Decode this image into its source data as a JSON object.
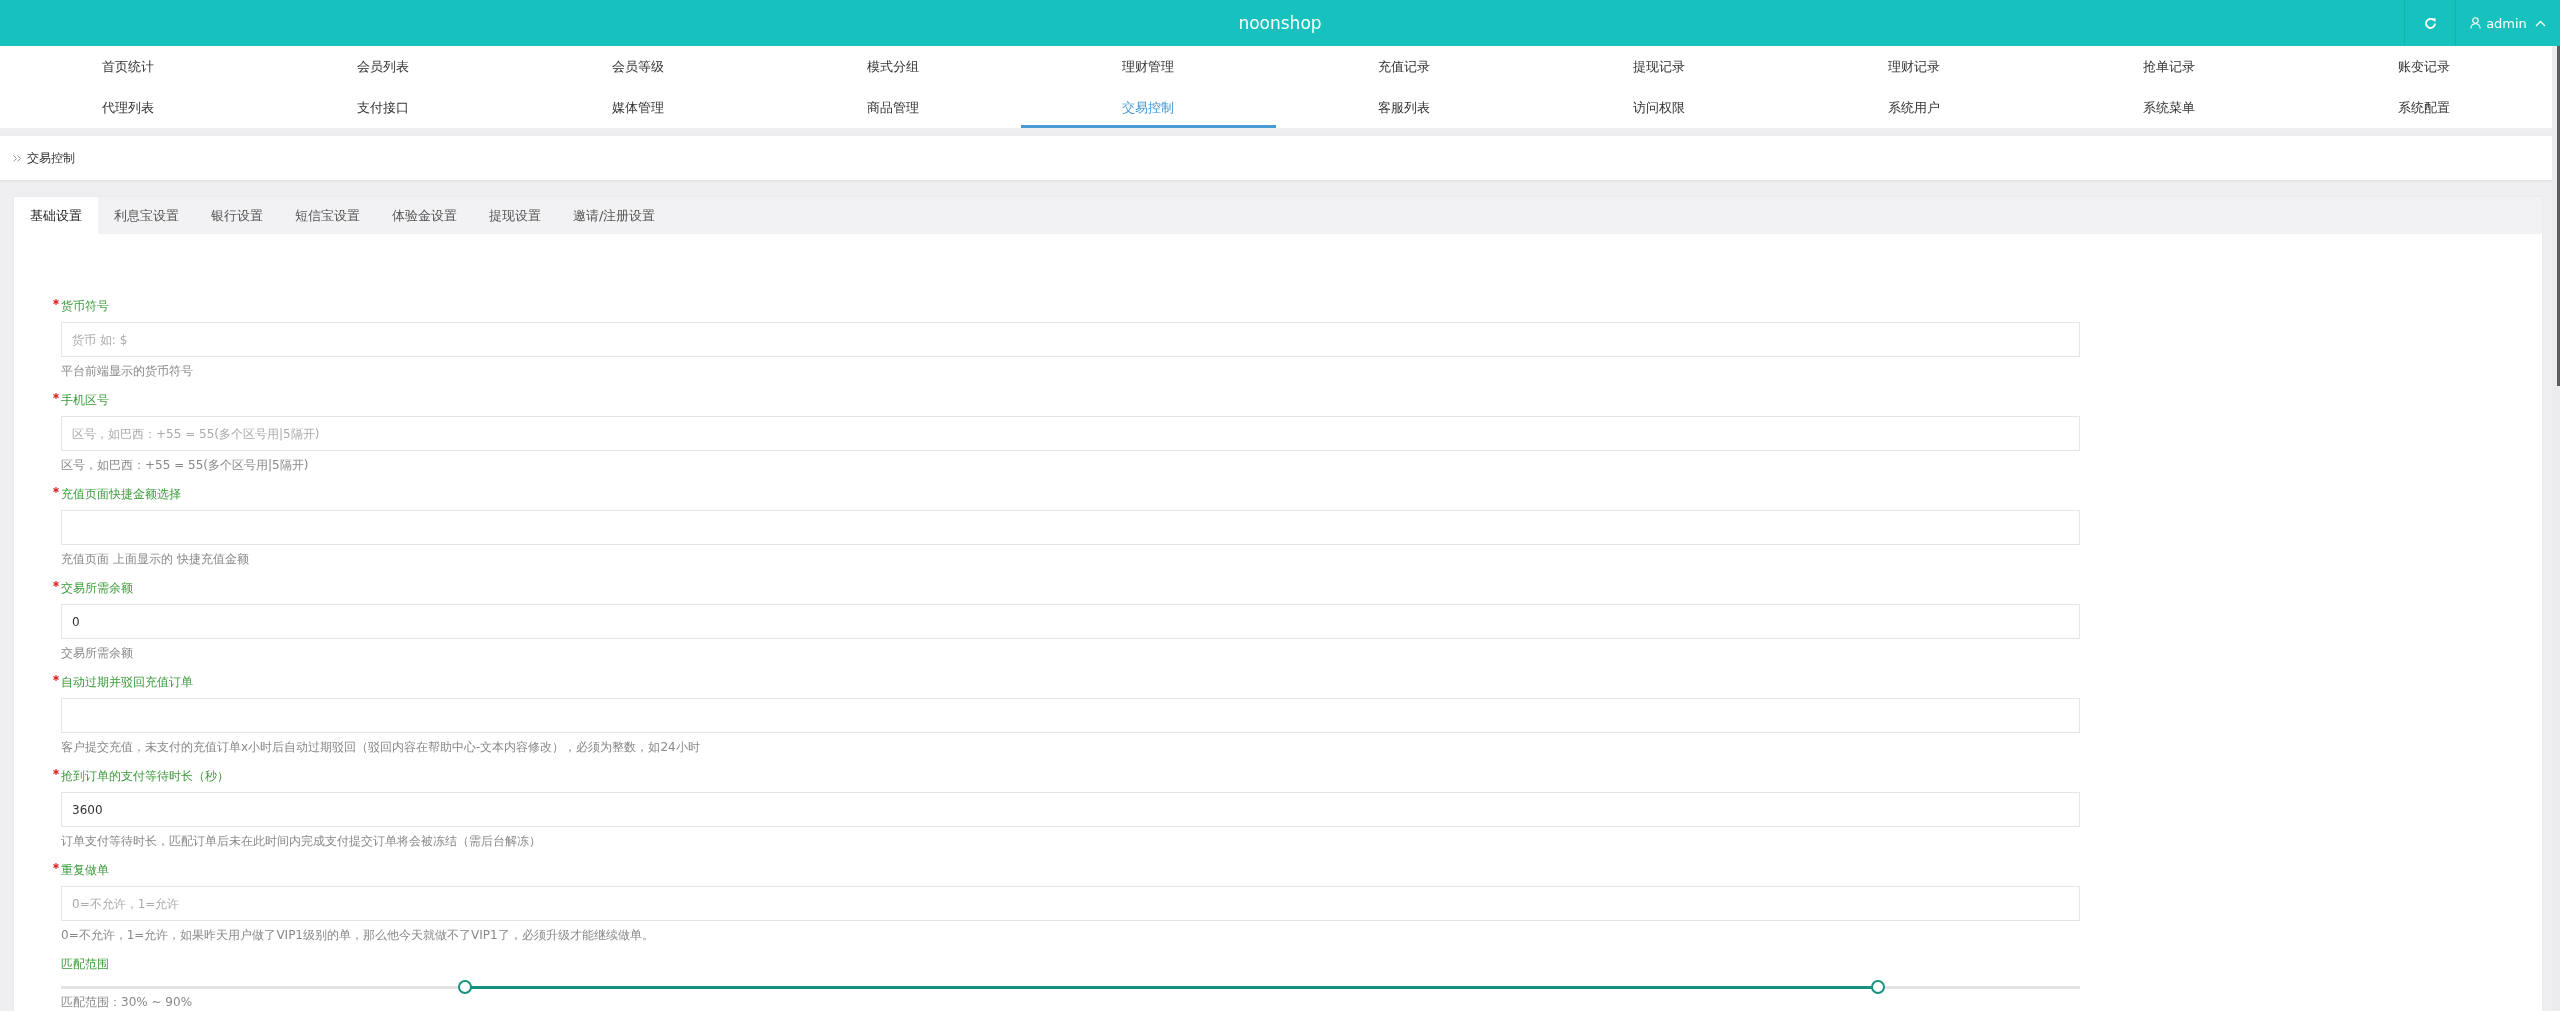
{
  "header": {
    "title": "noonshop",
    "user": "admin"
  },
  "nav": [
    {
      "label": "首页统计",
      "selected": false
    },
    {
      "label": "会员列表",
      "selected": false
    },
    {
      "label": "会员等级",
      "selected": false
    },
    {
      "label": "模式分组",
      "selected": false
    },
    {
      "label": "理财管理",
      "selected": false
    },
    {
      "label": "充值记录",
      "selected": false
    },
    {
      "label": "提现记录",
      "selected": false
    },
    {
      "label": "理财记录",
      "selected": false
    },
    {
      "label": "抢单记录",
      "selected": false
    },
    {
      "label": "账变记录",
      "selected": false
    },
    {
      "label": "代理列表",
      "selected": false
    },
    {
      "label": "支付接口",
      "selected": false
    },
    {
      "label": "媒体管理",
      "selected": false
    },
    {
      "label": "商品管理",
      "selected": false
    },
    {
      "label": "交易控制",
      "selected": true
    },
    {
      "label": "客服列表",
      "selected": false
    },
    {
      "label": "访问权限",
      "selected": false
    },
    {
      "label": "系统用户",
      "selected": false
    },
    {
      "label": "系统菜单",
      "selected": false
    },
    {
      "label": "系统配置",
      "selected": false
    }
  ],
  "breadcrumb": {
    "label": "交易控制"
  },
  "tabs": [
    {
      "label": "基础设置",
      "selected": true
    },
    {
      "label": "利息宝设置",
      "selected": false
    },
    {
      "label": "银行设置",
      "selected": false
    },
    {
      "label": "短信宝设置",
      "selected": false
    },
    {
      "label": "体验金设置",
      "selected": false
    },
    {
      "label": "提现设置",
      "selected": false
    },
    {
      "label": "邀请/注册设置",
      "selected": false
    }
  ],
  "fields": [
    {
      "kind": "input",
      "label": "货币符号",
      "required": true,
      "placeholder": "货币 如: $",
      "help": "平台前端显示的货币符号"
    },
    {
      "kind": "input",
      "label": "手机区号",
      "required": true,
      "placeholder": "区号，如巴西：+55 = 55(多个区号用|5隔开)",
      "help": "区号，如巴西：+55 = 55(多个区号用|5隔开)"
    },
    {
      "kind": "input",
      "label": "充值页面快捷金额选择",
      "required": true,
      "help": "充值页面 上面显示的 快捷充值金额"
    },
    {
      "kind": "input",
      "label": "交易所需余额",
      "required": true,
      "value": "0",
      "help": "交易所需余额"
    },
    {
      "kind": "input",
      "label": "自动过期并驳回充值订单",
      "required": true,
      "help": "客户提交充值，未支付的充值订单x小时后自动过期驳回（驳回内容在帮助中心-文本内容修改），必须为整数，如24小时"
    },
    {
      "kind": "input",
      "label": "抢到订单的支付等待时长（秒）",
      "required": true,
      "value": "3600",
      "help": "订单支付等待时长，匹配订单后未在此时间内完成支付提交订单将会被冻结（需后台解冻）"
    },
    {
      "kind": "input",
      "label": "重复做单",
      "required": true,
      "placeholder": "0=不允许，1=允许",
      "help": "0=不允许，1=允许，如果昨天用户做了VIP1级别的单，那么他今天就做不了VIP1了，必须升级才能继续做单。"
    },
    {
      "kind": "range",
      "label": "匹配范围",
      "required": false,
      "thumbs": [
        {
          "level": 0.2
        },
        {
          "level": 0.9
        }
      ],
      "help": "匹配范围：30% ~ 90%"
    }
  ]
}
